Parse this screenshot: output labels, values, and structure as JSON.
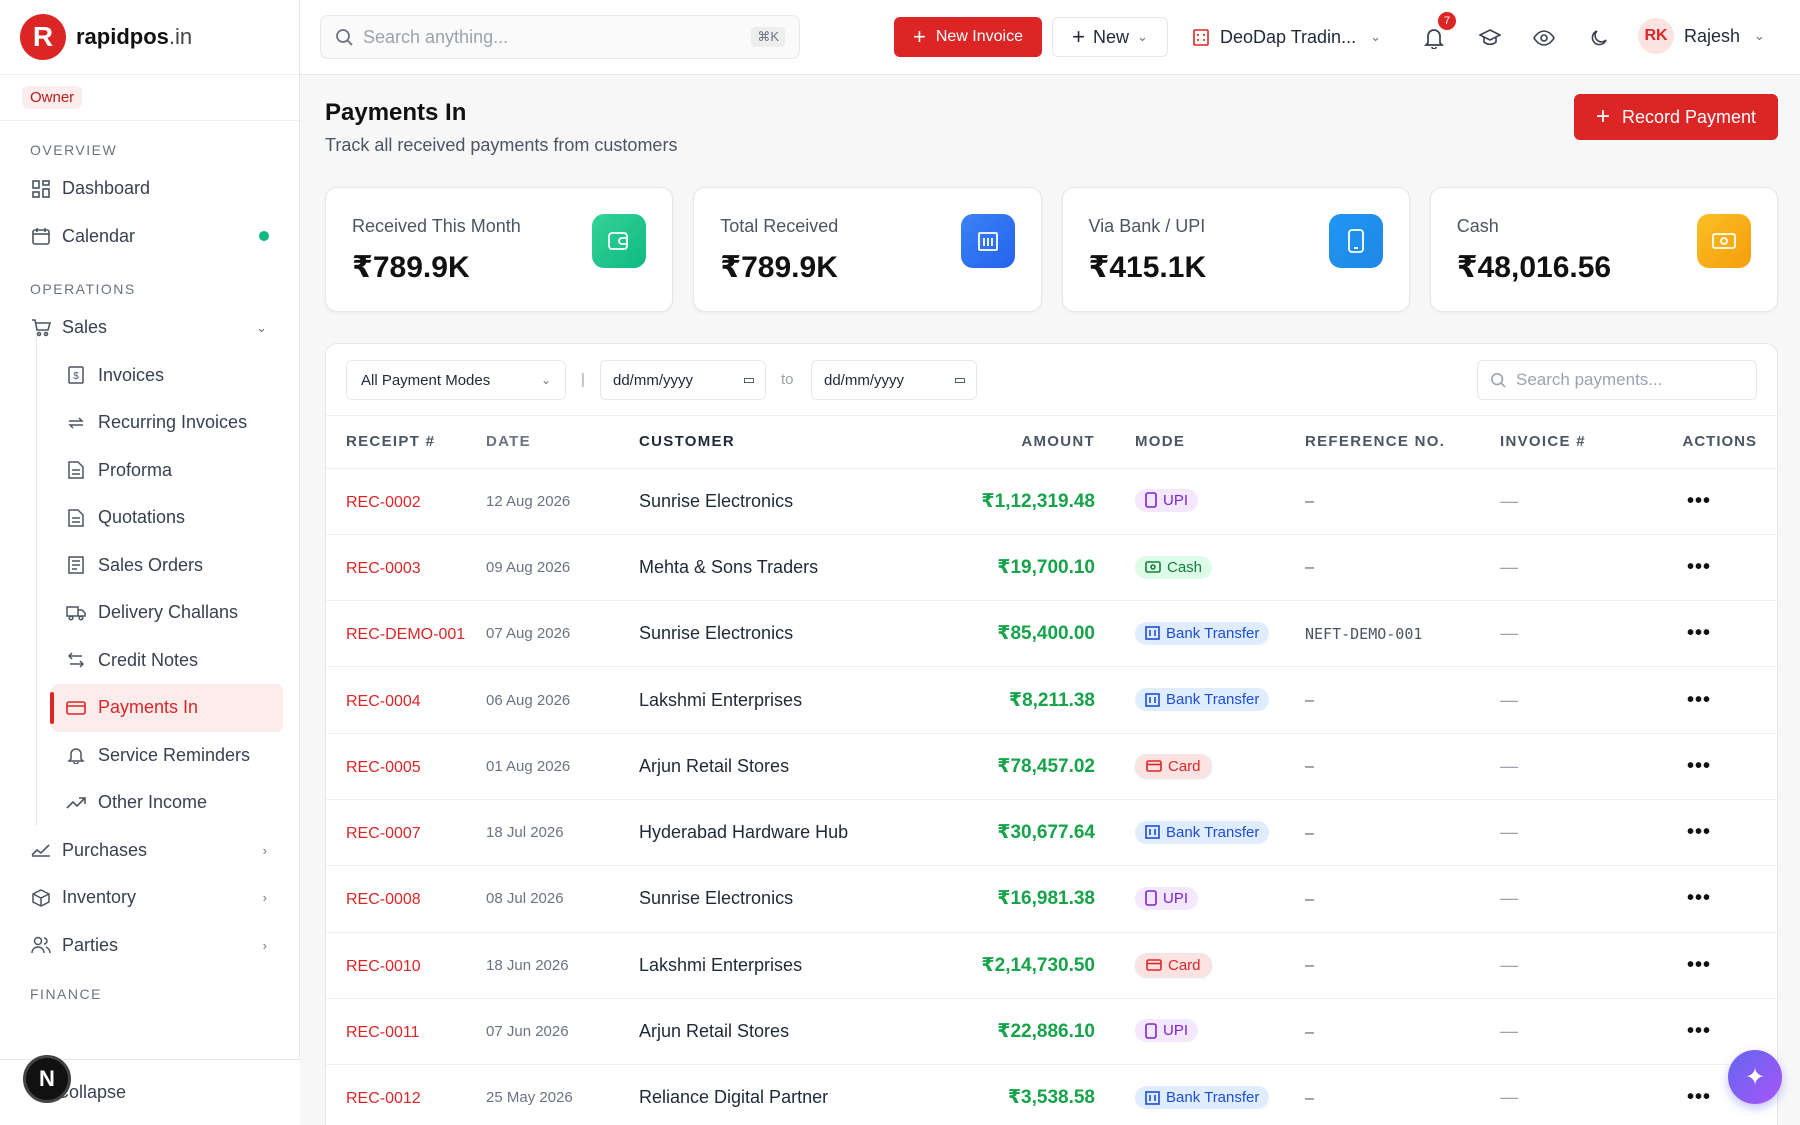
{
  "brand": {
    "logo_letter": "R",
    "name": "rapidpos",
    "tld": ".in"
  },
  "role": "Owner",
  "sidebar": {
    "overview_label": "OVERVIEW",
    "operations_label": "OPERATIONS",
    "finance_label": "FINANCE",
    "items": {
      "dashboard": "Dashboard",
      "calendar": "Calendar",
      "sales": "Sales",
      "purchases": "Purchases",
      "inventory": "Inventory",
      "parties": "Parties"
    },
    "sales_sub": [
      "Invoices",
      "Recurring Invoices",
      "Proforma",
      "Quotations",
      "Sales Orders",
      "Delivery Challans",
      "Credit Notes",
      "Payments In",
      "Service Reminders",
      "Other Income"
    ],
    "collapse": "Collapse"
  },
  "topbar": {
    "search_placeholder": "Search anything...",
    "shortcut": "⌘K",
    "new_invoice": "New Invoice",
    "new": "New",
    "company": "DeoDap Tradin...",
    "notifications": "7",
    "user_initials": "RK",
    "user_name": "Rajesh"
  },
  "page": {
    "title": "Payments In",
    "subtitle": "Track all received payments from customers",
    "record_button": "Record Payment"
  },
  "stats": [
    {
      "label": "Received This Month",
      "value": "₹789.9K",
      "color": "#10b981",
      "icon": "wallet-icon"
    },
    {
      "label": "Total Received",
      "value": "₹789.9K",
      "color": "#2563eb",
      "icon": "bank-icon"
    },
    {
      "label": "Via Bank / UPI",
      "value": "₹415.1K",
      "color": "#1e88e5",
      "icon": "phone-icon"
    },
    {
      "label": "Cash",
      "value": "₹48,016.56",
      "color": "#f59e0b",
      "icon": "cash-icon"
    }
  ],
  "filters": {
    "mode": "All Payment Modes",
    "date_from": "dd/mm/yyyy",
    "to": "to",
    "date_to": "dd/mm/yyyy",
    "search_placeholder": "Search payments...",
    "separator": "|"
  },
  "table": {
    "headers": [
      "RECEIPT #",
      "DATE",
      "CUSTOMER",
      "AMOUNT",
      "MODE",
      "REFERENCE NO.",
      "INVOICE #",
      "ACTIONS"
    ],
    "rows": [
      {
        "receipt": "REC-0002",
        "date": "12 Aug 2026",
        "customer": "Sunrise Electronics",
        "amount": "₹1,12,319.48",
        "mode": "UPI",
        "mode_type": "upi",
        "reference": "–",
        "invoice": "—"
      },
      {
        "receipt": "REC-0003",
        "date": "09 Aug 2026",
        "customer": "Mehta & Sons Traders",
        "amount": "₹19,700.10",
        "mode": "Cash",
        "mode_type": "cash",
        "reference": "–",
        "invoice": "—"
      },
      {
        "receipt": "REC-DEMO-001",
        "date": "07 Aug 2026",
        "customer": "Sunrise Electronics",
        "amount": "₹85,400.00",
        "mode": "Bank Transfer",
        "mode_type": "bank",
        "reference": "NEFT-DEMO-001",
        "invoice": "—"
      },
      {
        "receipt": "REC-0004",
        "date": "06 Aug 2026",
        "customer": "Lakshmi Enterprises",
        "amount": "₹8,211.38",
        "mode": "Bank Transfer",
        "mode_type": "bank",
        "reference": "–",
        "invoice": "—"
      },
      {
        "receipt": "REC-0005",
        "date": "01 Aug 2026",
        "customer": "Arjun Retail Stores",
        "amount": "₹78,457.02",
        "mode": "Card",
        "mode_type": "card",
        "reference": "–",
        "invoice": "—"
      },
      {
        "receipt": "REC-0007",
        "date": "18 Jul 2026",
        "customer": "Hyderabad Hardware Hub",
        "amount": "₹30,677.64",
        "mode": "Bank Transfer",
        "mode_type": "bank",
        "reference": "–",
        "invoice": "—"
      },
      {
        "receipt": "REC-0008",
        "date": "08 Jul 2026",
        "customer": "Sunrise Electronics",
        "amount": "₹16,981.38",
        "mode": "UPI",
        "mode_type": "upi",
        "reference": "–",
        "invoice": "—"
      },
      {
        "receipt": "REC-0010",
        "date": "18 Jun 2026",
        "customer": "Lakshmi Enterprises",
        "amount": "₹2,14,730.50",
        "mode": "Card",
        "mode_type": "card",
        "reference": "–",
        "invoice": "—"
      },
      {
        "receipt": "REC-0011",
        "date": "07 Jun 2026",
        "customer": "Arjun Retail Stores",
        "amount": "₹22,886.10",
        "mode": "UPI",
        "mode_type": "upi",
        "reference": "–",
        "invoice": "—"
      },
      {
        "receipt": "REC-0012",
        "date": "25 May 2026",
        "customer": "Reliance Digital Partner",
        "amount": "₹3,538.58",
        "mode": "Bank Transfer",
        "mode_type": "bank",
        "reference": "–",
        "invoice": "—"
      }
    ],
    "actions_glyph": "•••"
  }
}
